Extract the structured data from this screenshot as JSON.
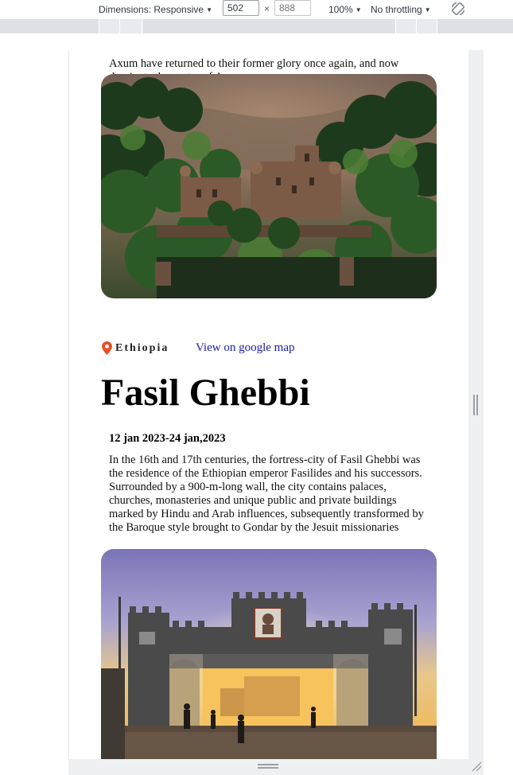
{
  "devtools": {
    "dimensions_label": "Dimensions: Responsive",
    "width_value": "502",
    "height_placeholder": "888",
    "zoom_label": "100%",
    "throttling_label": "No throttling",
    "icons": [
      "chevron-down-icon",
      "rotate-icon",
      "resize-handle-icon"
    ]
  },
  "page": {
    "previous_card_text": "Axum have returned to their former glory once again, and now dominate the centre of Axum.",
    "card": {
      "country": "Ethiopia",
      "map_link": "View on google map",
      "title": "Fasil Ghebbi",
      "dates": "12 jan 2023-24 jan,2023",
      "description": "In the 16th and 17th centuries, the fortress-city of Fasil Ghebbi was the residence of the Ethiopian emperor Fasilides and his successors. Surrounded by a 900-m-long wall, the city contains palaces, churches, monasteries and unique public and private buildings marked by Hindu and Arab influences, subsequently transformed by the Baroque style brought to Gondar by the Jesuit missionaries",
      "pin_icon": "location-pin-icon",
      "pin_color": "#e8502a"
    }
  }
}
